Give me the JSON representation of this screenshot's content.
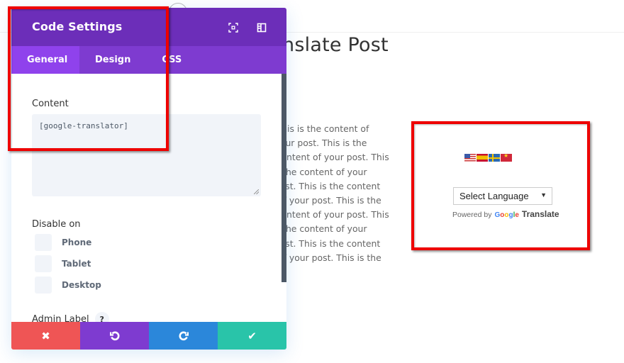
{
  "background_page": {
    "post_title": "ranslate Post",
    "post_body_lines": [
      "post. This is the content of",
      "nt of your post. This is the",
      "s the content of your post. This",
      " This is the content of your",
      "your post. This is the content",
      "ntent of your post. This is the",
      "s the content of your post. This",
      " This is the content of your",
      "your post. This is the content",
      "ntent of your post. This is the"
    ]
  },
  "translator_widget": {
    "flags": [
      "flag-us-icon",
      "flag-es-icon",
      "flag-se-icon",
      "flag-vn-icon"
    ],
    "select_language": "Select Language",
    "select_arrow": "▼",
    "powered_by": "Powered by",
    "google_letters": [
      "G",
      "o",
      "o",
      "g",
      "l",
      "e"
    ],
    "translate_word": "Translate"
  },
  "settings_panel": {
    "title": "Code Settings",
    "header_icons": [
      "expand-icon",
      "sidebar-icon"
    ],
    "tabs": [
      {
        "label": "General",
        "active": true
      },
      {
        "label": "Design",
        "active": false
      },
      {
        "label": "CSS",
        "active": false
      }
    ],
    "content_label": "Content",
    "content_value": "[google-translator]",
    "disable_on_label": "Disable on",
    "disable_on_options": [
      {
        "label": "Phone",
        "checked": false
      },
      {
        "label": "Tablet",
        "checked": false
      },
      {
        "label": "Desktop",
        "checked": false
      }
    ],
    "admin_label": "Admin Label",
    "help_glyph": "?",
    "actions": [
      {
        "name": "discard",
        "glyph": "✖",
        "color": "#ef5555"
      },
      {
        "name": "undo",
        "glyph": "↺",
        "color": "#7e3bd0"
      },
      {
        "name": "redo",
        "glyph": "↻",
        "color": "#2b87da"
      },
      {
        "name": "save",
        "glyph": "✔",
        "color": "#29c4a9"
      }
    ]
  },
  "colors": {
    "header": "#6c2eb9",
    "tabs": "#7e3bd0",
    "active_tab": "#8f42ec",
    "highlight": "#ee0000"
  }
}
